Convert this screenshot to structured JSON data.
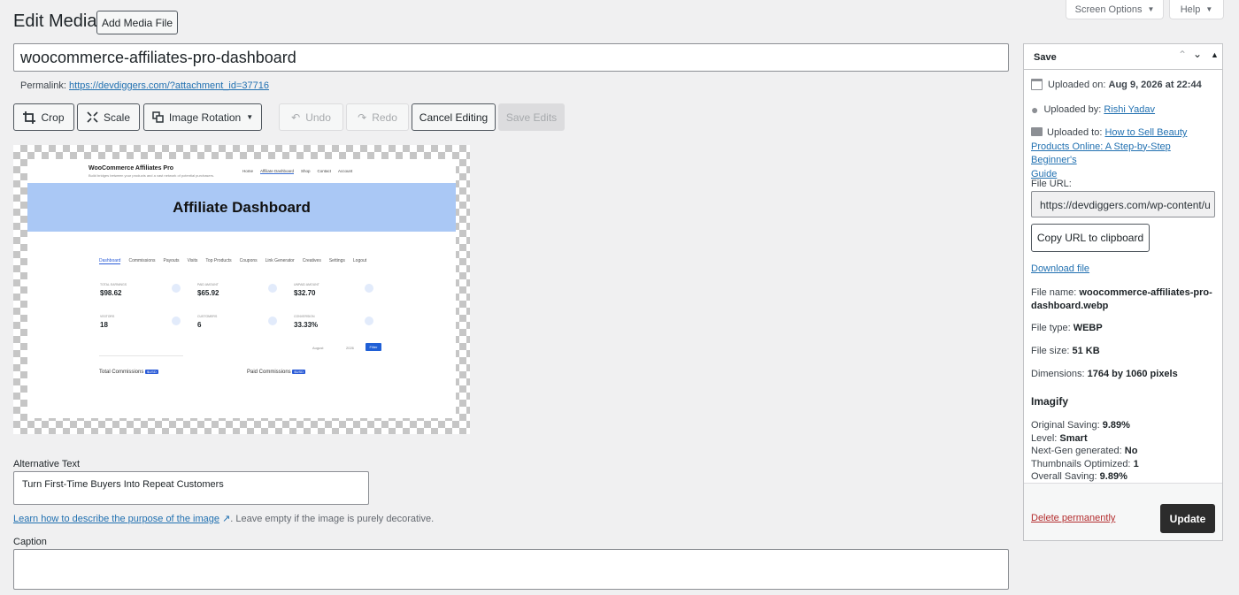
{
  "header": {
    "title": "Edit Media",
    "add_media_label": "Add Media File",
    "screen_options_label": "Screen Options",
    "help_label": "Help"
  },
  "title_input": {
    "value": "woocommerce-affiliates-pro-dashboard"
  },
  "permalink": {
    "label": "Permalink:",
    "url": "https://devdiggers.com/?attachment_id=37716"
  },
  "toolbar": {
    "crop": "Crop",
    "scale": "Scale",
    "rotation": "Image Rotation",
    "undo": "Undo",
    "redo": "Redo",
    "cancel": "Cancel Editing",
    "save": "Save Edits"
  },
  "preview": {
    "brand": "WooCommerce Affiliates Pro",
    "brand_sub": "Build bridges between your products and a vast network of potential purchasers.",
    "nav": [
      "Home",
      "Affiliate Dashboard",
      "Shop",
      "Contact",
      "Account"
    ],
    "hero": "Affiliate Dashboard",
    "tabs": [
      "Dashboard",
      "Commissions",
      "Payouts",
      "Visits",
      "Top Products",
      "Coupons",
      "Link Generator",
      "Creatives",
      "Settings",
      "Logout"
    ],
    "stats": [
      {
        "label": "TOTAL EARNINGS",
        "value": "$98.62"
      },
      {
        "label": "PAID AMOUNT",
        "value": "$65.92"
      },
      {
        "label": "UNPAID AMOUNT",
        "value": "$32.70"
      },
      {
        "label": "VISITORS",
        "value": "18"
      },
      {
        "label": "CUSTOMERS",
        "value": "6"
      },
      {
        "label": "CONVERSION",
        "value": "33.33%"
      }
    ],
    "filter_month": "August",
    "filter_year": "2026",
    "filter_btn": "Filter",
    "chart1": "Total Commissions",
    "chart2": "Paid Commissions",
    "badge": "$USD"
  },
  "alt_text": {
    "label": "Alternative Text",
    "value": "Turn First-Time Buyers Into Repeat Customers",
    "help_link": "Learn how to describe the purpose of the image",
    "help_rest": ". Leave empty if the image is purely decorative."
  },
  "caption": {
    "label": "Caption",
    "value": ""
  },
  "save_box": {
    "title": "Save",
    "uploaded_on_label": "Uploaded on:",
    "uploaded_on_value": "Aug 9, 2026 at 22:44",
    "uploaded_by_label": "Uploaded by:",
    "uploaded_by_value": "Rishi Yadav",
    "uploaded_to_label": "Uploaded to:",
    "uploaded_to_line1": "How to Sell Beauty",
    "uploaded_to_line2": "Products Online: A Step-by-Step Beginner's",
    "uploaded_to_line3": "Guide",
    "file_url_label": "File URL:",
    "file_url_value": "https://devdiggers.com/wp-content/u",
    "copy_label": "Copy URL to clipboard",
    "download_label": "Download file",
    "file_name_label": "File name:",
    "file_name_line1": "woocommerce-affiliates-pro-",
    "file_name_line2": "dashboard.webp",
    "file_type_label": "File type:",
    "file_type_value": "WEBP",
    "file_size_label": "File size:",
    "file_size_value": "51 KB",
    "dimensions_label": "Dimensions:",
    "dimensions_value": "1764 by 1060 pixels",
    "imagify_title": "Imagify",
    "original_saving_label": "Original Saving:",
    "original_saving_value": "9.89%",
    "level_label": "Level:",
    "level_value": "Smart",
    "nextgen_label": "Next-Gen generated:",
    "nextgen_value": "No",
    "thumbs_label": "Thumbnails Optimized:",
    "thumbs_value": "1",
    "overall_label": "Overall Saving:",
    "overall_value": "9.89%",
    "delete_label": "Delete permanently",
    "update_label": "Update"
  },
  "colors": {
    "accent": "#2271b1",
    "delete": "#b32d2e",
    "update_bg": "#2c2c2c",
    "hero_bg": "#aac8f5"
  }
}
